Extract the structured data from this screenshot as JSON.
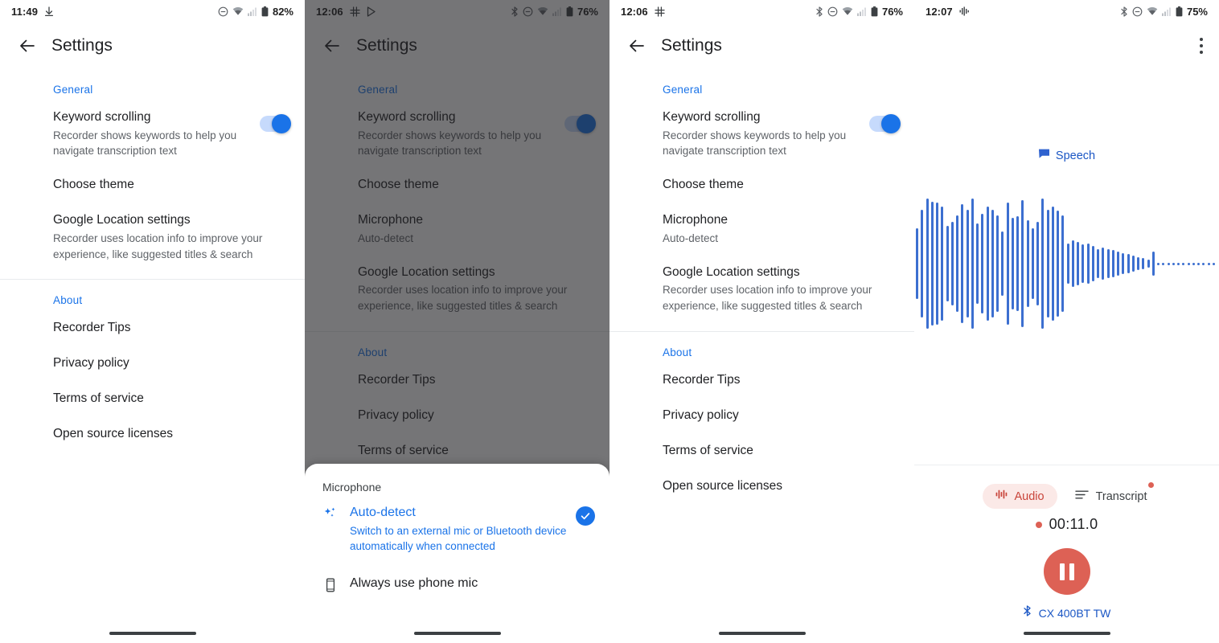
{
  "colors": {
    "accent_blue": "#1a73e8",
    "link_blue": "#1a56c4",
    "wave_blue": "#3c6fd0",
    "record_red": "#dd6155",
    "pill_bg": "#fbe9e7",
    "pill_text": "#c9443a",
    "text_primary": "#202124",
    "text_secondary": "#5f6368",
    "scrim": "rgba(32,33,36,0.62)"
  },
  "panels": [
    {
      "id": "settings-light",
      "status": {
        "time": "11:49",
        "left_icons": [
          "download-icon"
        ],
        "right_icons": [
          "do-not-disturb-icon",
          "wifi-icon",
          "signal-icon",
          "battery-icon"
        ],
        "battery": "82%"
      },
      "appbar": {
        "back": "back-arrow-icon",
        "title": "Settings",
        "overflow": false
      },
      "sections": [
        {
          "header": "General",
          "rows": [
            {
              "title": "Keyword scrolling",
              "sub": "Recorder shows keywords to help you navigate transcription text",
              "control": "switch",
              "switch_on": true
            },
            {
              "title": "Choose theme",
              "sub": "",
              "control": "none"
            },
            {
              "title": "Google Location settings",
              "sub": "Recorder uses location info to improve your experience, like suggested titles & search",
              "control": "none"
            }
          ]
        },
        {
          "header": "About",
          "rows": [
            {
              "title": "Recorder Tips",
              "sub": "",
              "control": "none"
            },
            {
              "title": "Privacy policy",
              "sub": "",
              "control": "none"
            },
            {
              "title": "Terms of service",
              "sub": "",
              "control": "none"
            },
            {
              "title": "Open source licenses",
              "sub": "",
              "control": "none"
            }
          ]
        }
      ],
      "sheet": null
    },
    {
      "id": "settings-sheet",
      "scrim": true,
      "status": {
        "time": "12:06",
        "left_icons": [
          "slack-icon",
          "play-store-icon"
        ],
        "right_icons": [
          "bluetooth-icon",
          "do-not-disturb-icon",
          "wifi-icon",
          "signal-icon",
          "battery-icon"
        ],
        "battery": "76%"
      },
      "appbar": {
        "back": "back-arrow-icon",
        "title": "Settings",
        "overflow": false
      },
      "sections": [
        {
          "header": "General",
          "rows": [
            {
              "title": "Keyword scrolling",
              "sub": "Recorder shows keywords to help you navigate transcription text",
              "control": "switch",
              "switch_on": true
            },
            {
              "title": "Choose theme",
              "sub": "",
              "control": "none"
            },
            {
              "title": "Microphone",
              "sub": "Auto-detect",
              "control": "none"
            },
            {
              "title": "Google Location settings",
              "sub": "Recorder uses location info to improve your experience, like suggested titles & search",
              "control": "none"
            }
          ]
        },
        {
          "header": "About",
          "rows": [
            {
              "title": "Recorder Tips",
              "sub": "",
              "control": "none"
            },
            {
              "title": "Privacy policy",
              "sub": "",
              "control": "none"
            },
            {
              "title": "Terms of service",
              "sub": "",
              "control": "none"
            }
          ]
        }
      ],
      "sheet": {
        "title": "Microphone",
        "options": [
          {
            "icon": "sparkles-icon",
            "title": "Auto-detect",
            "sub": "Switch to an external mic or Bluetooth device automatically when connected",
            "selected": true
          },
          {
            "icon": "phone-icon",
            "title": "Always use phone mic",
            "sub": "",
            "selected": false
          }
        ]
      }
    },
    {
      "id": "settings-mic",
      "status": {
        "time": "12:06",
        "left_icons": [
          "slack-icon"
        ],
        "right_icons": [
          "bluetooth-icon",
          "do-not-disturb-icon",
          "wifi-icon",
          "signal-icon",
          "battery-icon"
        ],
        "battery": "76%"
      },
      "appbar": {
        "back": "back-arrow-icon",
        "title": "Settings",
        "overflow": false
      },
      "sections": [
        {
          "header": "General",
          "rows": [
            {
              "title": "Keyword scrolling",
              "sub": "Recorder shows keywords to help you navigate transcription text",
              "control": "switch",
              "switch_on": true
            },
            {
              "title": "Choose theme",
              "sub": "",
              "control": "none"
            },
            {
              "title": "Microphone",
              "sub": "Auto-detect",
              "control": "none"
            },
            {
              "title": "Google Location settings",
              "sub": "Recorder uses location info to improve your experience, like suggested titles & search",
              "control": "none"
            }
          ]
        },
        {
          "header": "About",
          "rows": [
            {
              "title": "Recorder Tips",
              "sub": "",
              "control": "none"
            },
            {
              "title": "Privacy policy",
              "sub": "",
              "control": "none"
            },
            {
              "title": "Terms of service",
              "sub": "",
              "control": "none"
            },
            {
              "title": "Open source licenses",
              "sub": "",
              "control": "none"
            }
          ]
        }
      ],
      "sheet": null
    }
  ],
  "recorder": {
    "status": {
      "time": "12:07",
      "left_icons": [
        "recording-waveform-icon"
      ],
      "right_icons": [
        "bluetooth-icon",
        "do-not-disturb-icon",
        "wifi-icon",
        "signal-icon",
        "battery-icon"
      ],
      "battery": "75%"
    },
    "overflow_icon": "more-vert-icon",
    "speech_tag": {
      "icon": "speech-bubble-icon",
      "label": "Speech"
    },
    "tabs": [
      {
        "id": "audio",
        "label": "Audio",
        "icon": "audio-bars-icon",
        "active": true,
        "badge": false
      },
      {
        "id": "transcript",
        "label": "Transcript",
        "icon": "transcript-lines-icon",
        "active": false,
        "badge": true
      }
    ],
    "timer": "00:11.0",
    "recording": true,
    "action_button": "pause-button",
    "device": {
      "icon": "bluetooth-icon",
      "name": "CX 400BT TW"
    },
    "waveform": [
      52,
      80,
      96,
      92,
      90,
      84,
      56,
      62,
      72,
      88,
      80,
      96,
      60,
      74,
      84,
      80,
      72,
      48,
      90,
      68,
      70,
      94,
      64,
      52,
      62,
      96,
      80,
      84,
      78,
      72,
      30,
      34,
      32,
      28,
      30,
      26,
      22,
      24,
      22,
      20,
      18,
      16,
      14,
      12,
      10,
      8,
      6,
      18,
      4,
      4,
      4,
      4,
      4,
      4,
      4,
      4,
      4,
      4,
      4,
      4
    ]
  }
}
